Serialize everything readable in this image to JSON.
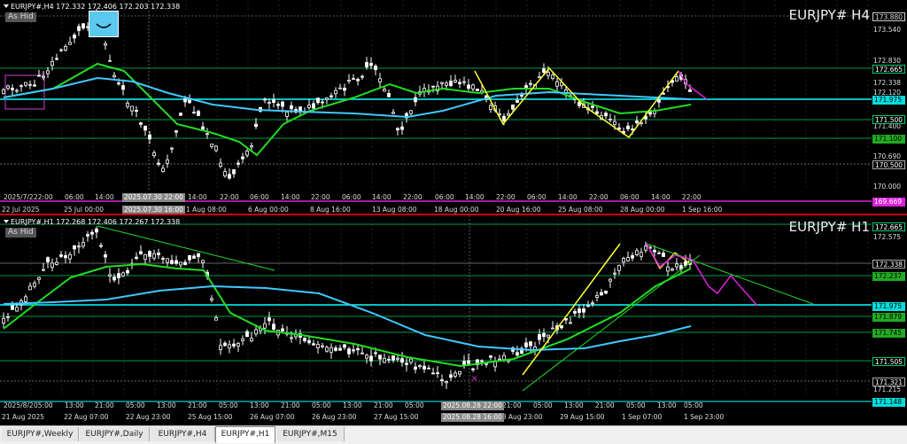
{
  "h4": {
    "header": "EURJPY#,H4  172.332 172.406 172.203 172.338",
    "hide_label": "As Hid",
    "title": "EURJPY# H4",
    "price_labels": [
      "173.880",
      "173.540",
      "172.830",
      "172.665",
      "172.338",
      "172.120",
      "171.975",
      "171.500",
      "171.400",
      "171.100",
      "170.690",
      "170.500",
      "170.000",
      "169.669"
    ],
    "time_labels": [
      "2025/7/2",
      "22:00",
      "06:00",
      "14:00",
      "22:00",
      "14:00",
      "22:00",
      "06:00",
      "14:00",
      "22:00",
      "06:00",
      "14:00",
      "22:00",
      "06:00",
      "14:00",
      "22:00",
      "06:00",
      "14:00",
      "22:00",
      "06:00",
      "14:00",
      "22:00"
    ],
    "date_labels": [
      "22 Jul 2025",
      "25 Jul 00:00",
      "1 Aug 08:00",
      "6 Aug 00:00",
      "8 Aug 16:00",
      "13 Aug 08:00",
      "18 Aug 00:00",
      "20 Aug 16:00",
      "25 Aug 08:00",
      "28 Aug 00:00",
      "1 Sep 16:00"
    ],
    "crosshair_tag": "2025.07.30 22:00",
    "crosshair_tag2": "2025.07.30 16:00"
  },
  "h1": {
    "header": "EURJPY#,H1  172.268 172.406 172.267 172.338",
    "hide_label": "As Hid",
    "title": "EURJPY# H1",
    "price_labels": [
      "172.665",
      "172.575",
      "172.338",
      "172.237",
      "171.975",
      "171.879",
      "171.745",
      "171.505",
      "171.321",
      "171.215",
      "171.148"
    ],
    "time_labels": [
      "2025/8/2",
      "05:00",
      "13:00",
      "21:00",
      "05:00",
      "13:00",
      "21:00",
      "05:00",
      "13:00",
      "21:00",
      "05:00",
      "13:00",
      "21:00",
      "05:00",
      "13:00",
      "21:00",
      "05:00",
      "13:00",
      "21:00",
      "05:00",
      "13:00",
      "21:00",
      "05:00"
    ],
    "date_labels": [
      "21 Aug 2025",
      "22 Aug 07:00",
      "22 Aug 23:00",
      "25 Aug 15:00",
      "26 Aug 07:00",
      "26 Aug 23:00",
      "27 Aug 15:00",
      "28 Aug 23:00",
      "29 Aug 15:00",
      "1 Sep 07:00",
      "1 Sep 23:00"
    ],
    "crosshair_tag": "2025.08.28 22:00",
    "crosshair_tag2": "2025.08.28 16:00"
  },
  "tabs": [
    "EURJPY#,Weekly",
    "EURJPY#,Daily",
    "EURJPY#,H4",
    "EURJPY#,H1",
    "EURJPY#,M15"
  ],
  "active_tab": "EURJPY#,H1",
  "colors": {
    "up": "#00ff00",
    "ma_fast": "#22dd22",
    "ma_slow": "#40c8ff",
    "zigzag": "#ffff33",
    "projection": "#dd22dd",
    "grid": "#00cc66",
    "horizontal": "#00ffff"
  }
}
